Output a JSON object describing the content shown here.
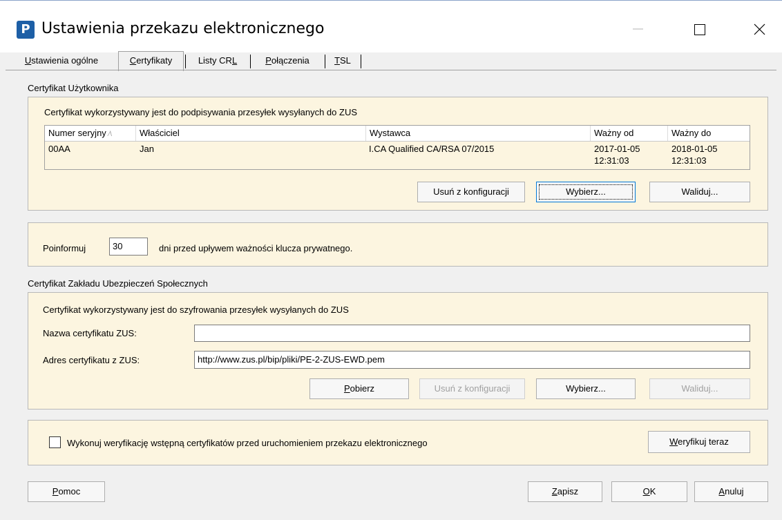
{
  "window": {
    "title": "Ustawienia przekazu elektronicznego",
    "icon": "P"
  },
  "tabs": [
    {
      "label": "Ustawienia ogólne",
      "accel": "U",
      "rest": "stawienia ogólne",
      "active": false
    },
    {
      "label": "Certyfikaty",
      "accel": "C",
      "rest": "ertyfikaty",
      "active": true
    },
    {
      "label": "Listy CRL",
      "pre": "Listy CR",
      "accel": "L",
      "active": false
    },
    {
      "label": "Połączenia",
      "accel": "P",
      "rest": "ołączenia",
      "active": false
    },
    {
      "label": "TSL",
      "accel": "T",
      "rest": "SL",
      "active": false
    }
  ],
  "user_cert": {
    "section_label": "Certyfikat Użytkownika",
    "description": "Certyfikat wykorzystywany jest do podpisywania przesyłek wysyłanych do ZUS",
    "columns": [
      "Numer seryjny",
      "Właściciel",
      "Wystawca",
      "Ważny od",
      "Ważny do"
    ],
    "sort_indicator": "⁄\\",
    "rows": [
      {
        "serial": "00AA",
        "owner": "Jan",
        "issuer": "I.CA Qualified CA/RSA 07/2015",
        "valid_from": "2017-01-05\n12:31:03",
        "valid_to": "2018-01-05\n12:31:03"
      }
    ],
    "buttons": {
      "remove": "Usuń z konfiguracji",
      "choose": "Wybierz...",
      "validate": "Waliduj..."
    }
  },
  "notify": {
    "prefix": "Poinformuj",
    "days": "30",
    "suffix": "dni przed upływem ważności klucza prywatnego."
  },
  "zus_cert": {
    "section_label": "Certyfikat Zakładu Ubezpieczeń Społecznych",
    "description": "Certyfikat wykorzystywany jest do szyfrowania przesyłek wysyłanych do ZUS",
    "name_label": "Nazwa certyfikatu ZUS:",
    "name_value": "",
    "address_label": "Adres certyfikatu z ZUS:",
    "address_value": "http://www.zus.pl/bip/pliki/PE-2-ZUS-EWD.pem",
    "buttons": {
      "fetch_accel": "P",
      "fetch_rest": "obierz",
      "remove": "Usuń z konfiguracji",
      "choose": "Wybierz...",
      "validate": "Waliduj..."
    }
  },
  "verify": {
    "checkbox_label": "Wykonuj weryfikację wstępną certyfikatów przed uruchomieniem przekazu elektronicznego",
    "checked": false,
    "button_accel": "W",
    "button_rest": "eryfikuj teraz"
  },
  "footer": {
    "help_accel": "P",
    "help_rest": "omoc",
    "save_accel": "Z",
    "save_rest": "apisz",
    "ok_accel": "O",
    "ok_rest": "K",
    "cancel_accel": "A",
    "cancel_rest": "nuluj"
  }
}
